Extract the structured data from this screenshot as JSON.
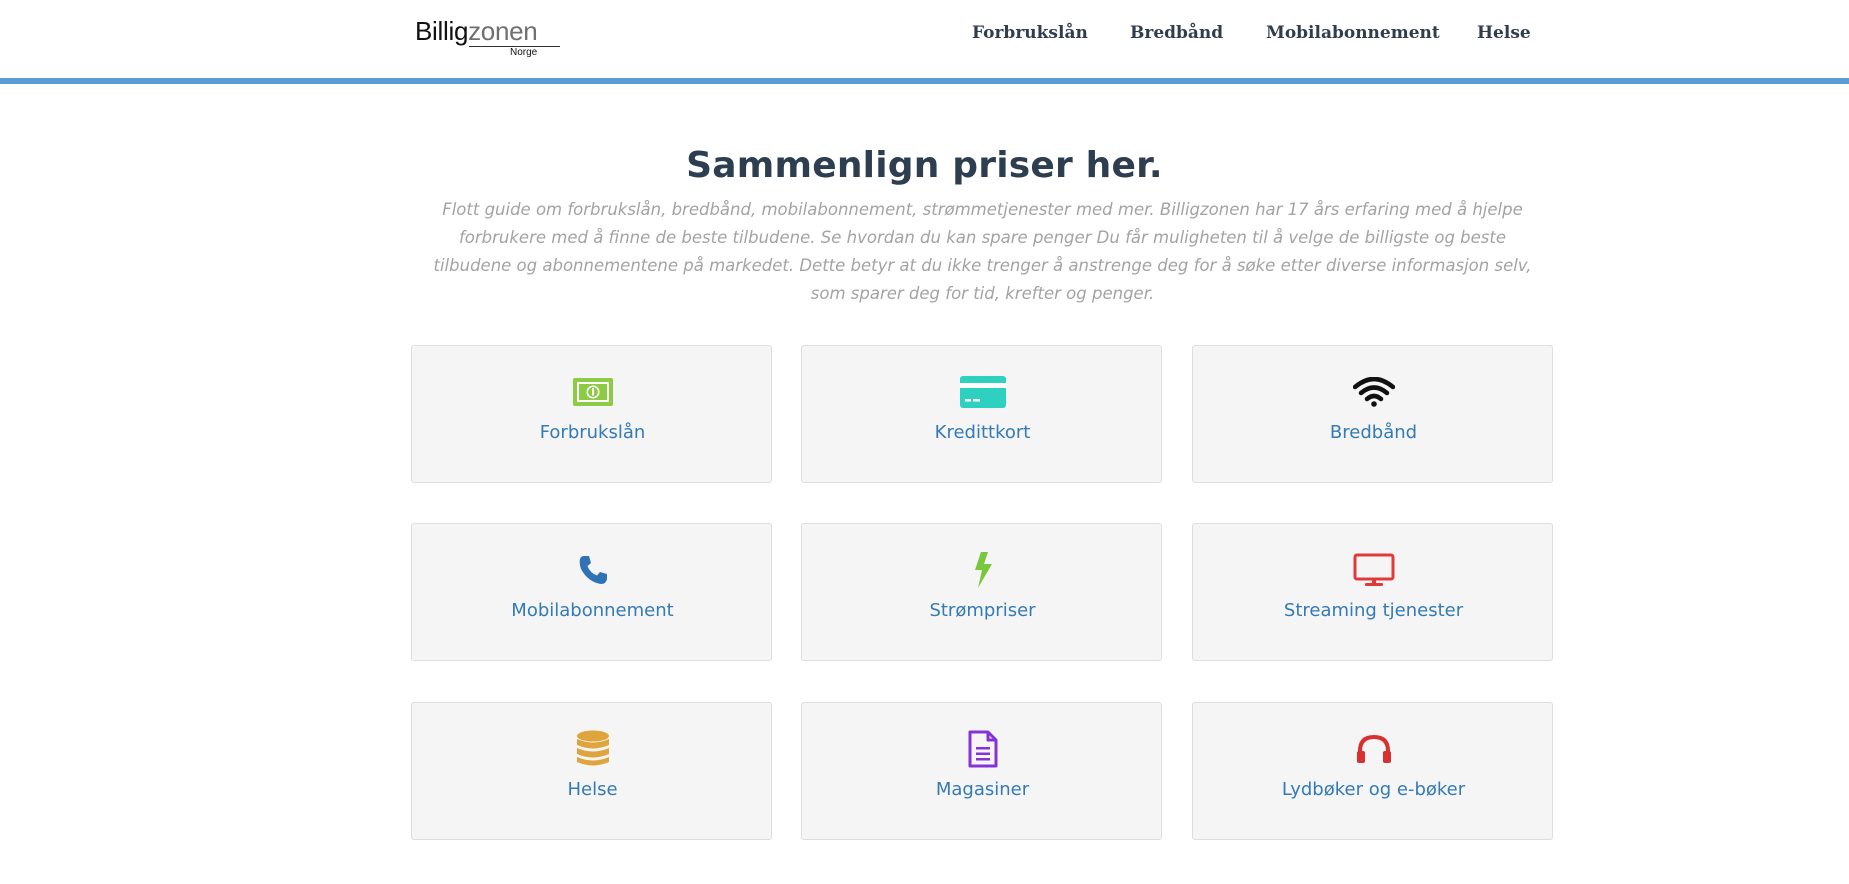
{
  "logo": {
    "part1": "Billig",
    "part2": "zonen",
    "sub": "Norge"
  },
  "nav": [
    {
      "label": "Forbrukslån"
    },
    {
      "label": "Bredbånd"
    },
    {
      "label": "Mobilabonnement"
    },
    {
      "label": "Helse"
    }
  ],
  "hero": {
    "title": "Sammenlign priser her.",
    "text": "Flott guide om forbrukslån, bredbånd, mobilabonnement, strømmetjenester med mer. Billigzonen har 17 års erfaring med å hjelpe forbrukere med å finne de beste tilbudene. Se hvordan du kan spare penger Du får muligheten til å velge de billigste og beste tilbudene og abonnementene på markedet. Dette betyr at du ikke trenger å anstrenge deg for å søke etter diverse informasjon selv, som sparer deg for tid, krefter og penger."
  },
  "cards": [
    {
      "label": "Forbrukslån",
      "icon": "money-bill-icon",
      "color": "#8dcb44"
    },
    {
      "label": "Kredittkort",
      "icon": "credit-card-icon",
      "color": "#2ed0c0"
    },
    {
      "label": "Bredbånd",
      "icon": "wifi-icon",
      "color": "#111111"
    },
    {
      "label": "Mobilabonnement",
      "icon": "phone-icon",
      "color": "#2f72b6"
    },
    {
      "label": "Strømpriser",
      "icon": "lightning-icon",
      "color": "#79c73d"
    },
    {
      "label": "Streaming tjenester",
      "icon": "monitor-icon",
      "color": "#e13a3a"
    },
    {
      "label": "Helse",
      "icon": "database-icon",
      "color": "#e0a43d"
    },
    {
      "label": "Magasiner",
      "icon": "document-icon",
      "color": "#8533d8"
    },
    {
      "label": "Lydbøker og e-bøker",
      "icon": "headphones-icon",
      "color": "#d7302f"
    }
  ],
  "colors": {
    "accent_bar": "#5b9bd5",
    "card_label": "#337ab7",
    "title": "#2d3e50",
    "muted_text": "#a3a3a3"
  }
}
